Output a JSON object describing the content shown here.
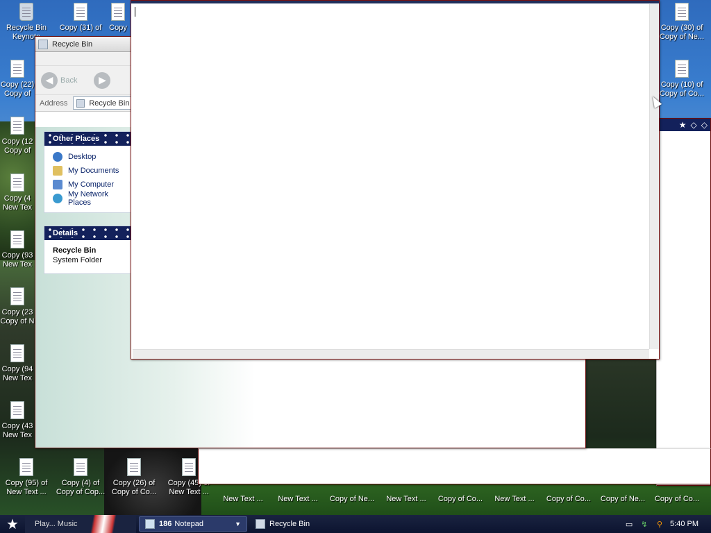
{
  "desktop": {
    "icons": [
      {
        "line1": "Recycle Bin",
        "line2": "Keynote",
        "type": "bin"
      },
      {
        "line1": "Copy (31) of",
        "line2": "",
        "type": "txt"
      },
      {
        "line1": "Copy",
        "line2": "",
        "type": "txt"
      },
      {
        "line1": "Copy (22)",
        "line2": "Copy of",
        "type": "txt"
      },
      {
        "line1": "Copy (12",
        "line2": "Copy of",
        "type": "txt"
      },
      {
        "line1": "Copy (4",
        "line2": "New Tex",
        "type": "txt"
      },
      {
        "line1": "Copy (93",
        "line2": "New Tex",
        "type": "txt"
      },
      {
        "line1": "Copy (23",
        "line2": "Copy of N",
        "type": "txt"
      },
      {
        "line1": "Copy (94",
        "line2": "New Tex",
        "type": "txt"
      },
      {
        "line1": "Copy (43",
        "line2": "New Tex",
        "type": "txt"
      },
      {
        "line1": "Copy (95) of",
        "line2": "New Text ...",
        "type": "txt"
      },
      {
        "line1": "Copy (4) of",
        "line2": "Copy of Cop...",
        "type": "txt"
      },
      {
        "line1": "Copy (26) of",
        "line2": "Copy of Co...",
        "type": "txt"
      },
      {
        "line1": "Copy (45) of",
        "line2": "New Text ...",
        "type": "txt"
      },
      {
        "line1": "Copy (30) of",
        "line2": "Copy of Ne...",
        "type": "txt"
      },
      {
        "line1": "Copy (10) of",
        "line2": "Copy of Co...",
        "type": "txt"
      }
    ],
    "bottom_row_labels": [
      "New Text ...",
      "New Text ...",
      "Copy of Ne...",
      "New Text ...",
      "Copy of Co...",
      "New Text ...",
      "Copy of Co...",
      "Copy of Ne...",
      "Copy of Co..."
    ]
  },
  "recycle_window": {
    "title": "Recycle Bin",
    "back_label": "Back",
    "address_label": "Address",
    "address_value": "Recycle Bin",
    "other_places": {
      "header": "Other Places",
      "links": [
        "Desktop",
        "My Documents",
        "My Computer",
        "My Network Places"
      ]
    },
    "details": {
      "header": "Details",
      "name": "Recycle Bin",
      "kind": "System Folder"
    }
  },
  "notepad_window": {
    "content": ""
  },
  "taskbar": {
    "quicklaunch_label": "Play... Music",
    "buttons": [
      {
        "count": "186",
        "label": "Notepad",
        "active": true
      },
      {
        "count": "",
        "label": "Recycle Bin",
        "active": false
      }
    ],
    "clock": "5:40 PM"
  },
  "colors": {
    "taskbar": "#0c1430",
    "panel_header": "#13215b",
    "window_border": "#7a1010"
  }
}
